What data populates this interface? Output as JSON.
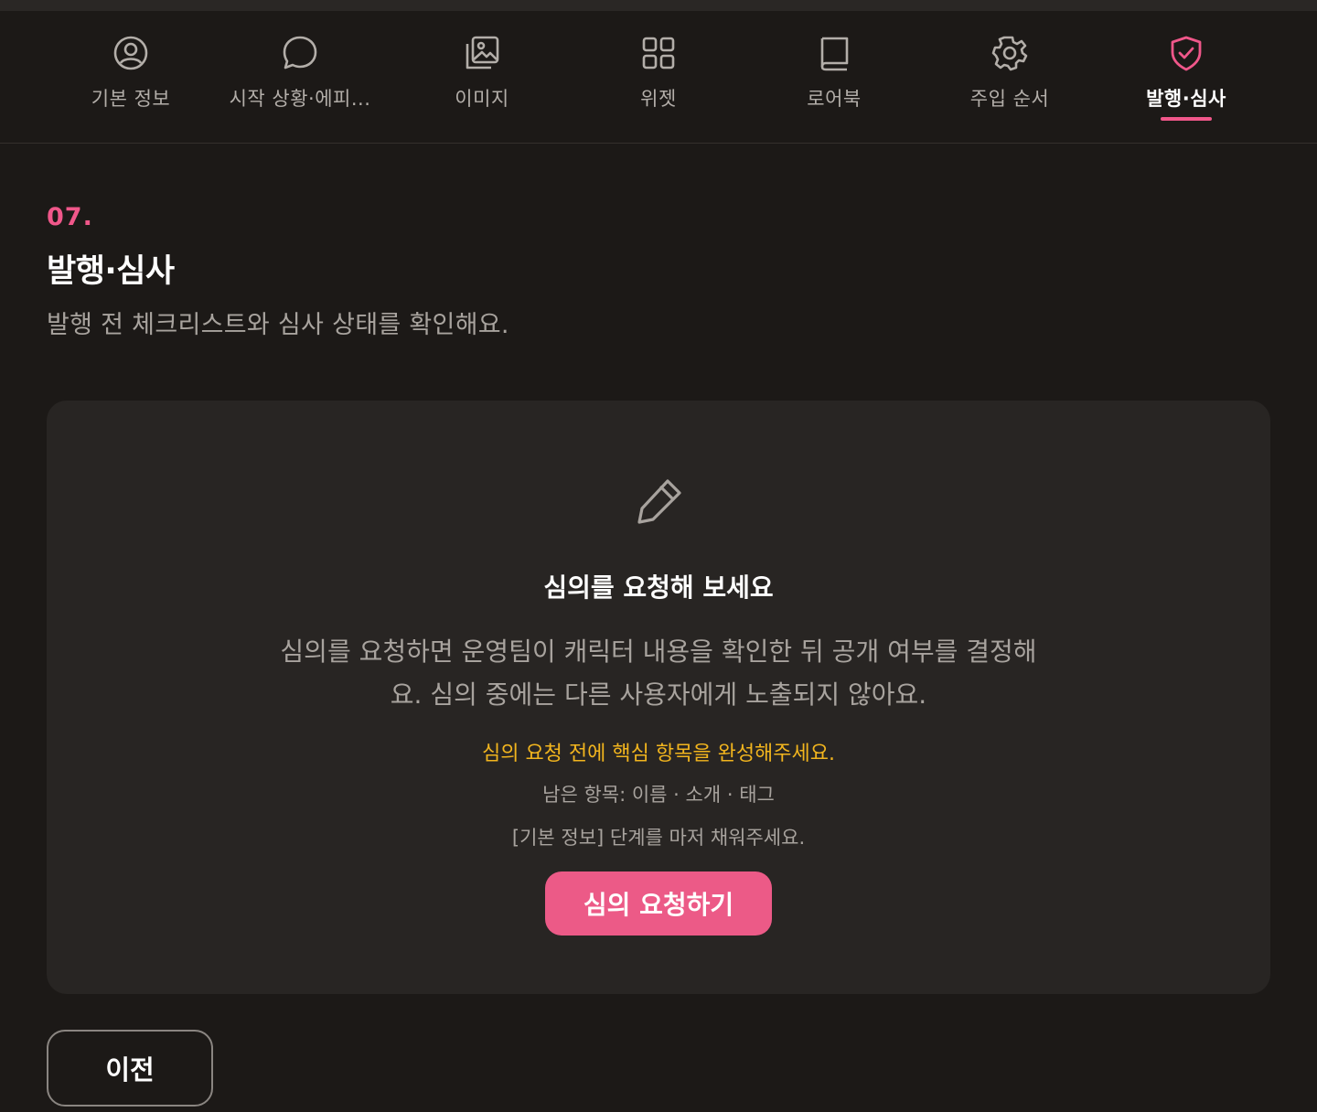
{
  "tabs": [
    {
      "label": "기본 정보",
      "icon": "user-circle-icon"
    },
    {
      "label": "시작 상황·에피...",
      "icon": "chat-bubble-icon"
    },
    {
      "label": "이미지",
      "icon": "image-icon"
    },
    {
      "label": "위젯",
      "icon": "grid-icon"
    },
    {
      "label": "로어북",
      "icon": "book-icon"
    },
    {
      "label": "주입 순서",
      "icon": "gear-icon"
    },
    {
      "label": "발행·심사",
      "icon": "shield-check-icon",
      "active": true
    }
  ],
  "section": {
    "number": "07.",
    "title": "발행·심사",
    "description": "발행 전 체크리스트와 심사 상태를 확인해요."
  },
  "card": {
    "icon": "pencil-icon",
    "title": "심의를 요청해 보세요",
    "description": "심의를 요청하면 운영팀이 캐릭터 내용을 확인한 뒤 공개 여부를 결정해요. 심의 중에는 다른 사용자에게 노출되지 않아요.",
    "warning": "심의 요청 전에 핵심 항목을 완성해주세요.",
    "remaining": "남은 항목: 이름 · 소개 · 태그",
    "hint": "[기본 정보] 단계를 마저 채워주세요.",
    "button_label": "심의 요청하기"
  },
  "footer": {
    "prev_label": "이전"
  },
  "colors": {
    "accent": "#f0578a",
    "warning": "#f2b51e",
    "background": "#1c1917",
    "card": "#282523"
  }
}
